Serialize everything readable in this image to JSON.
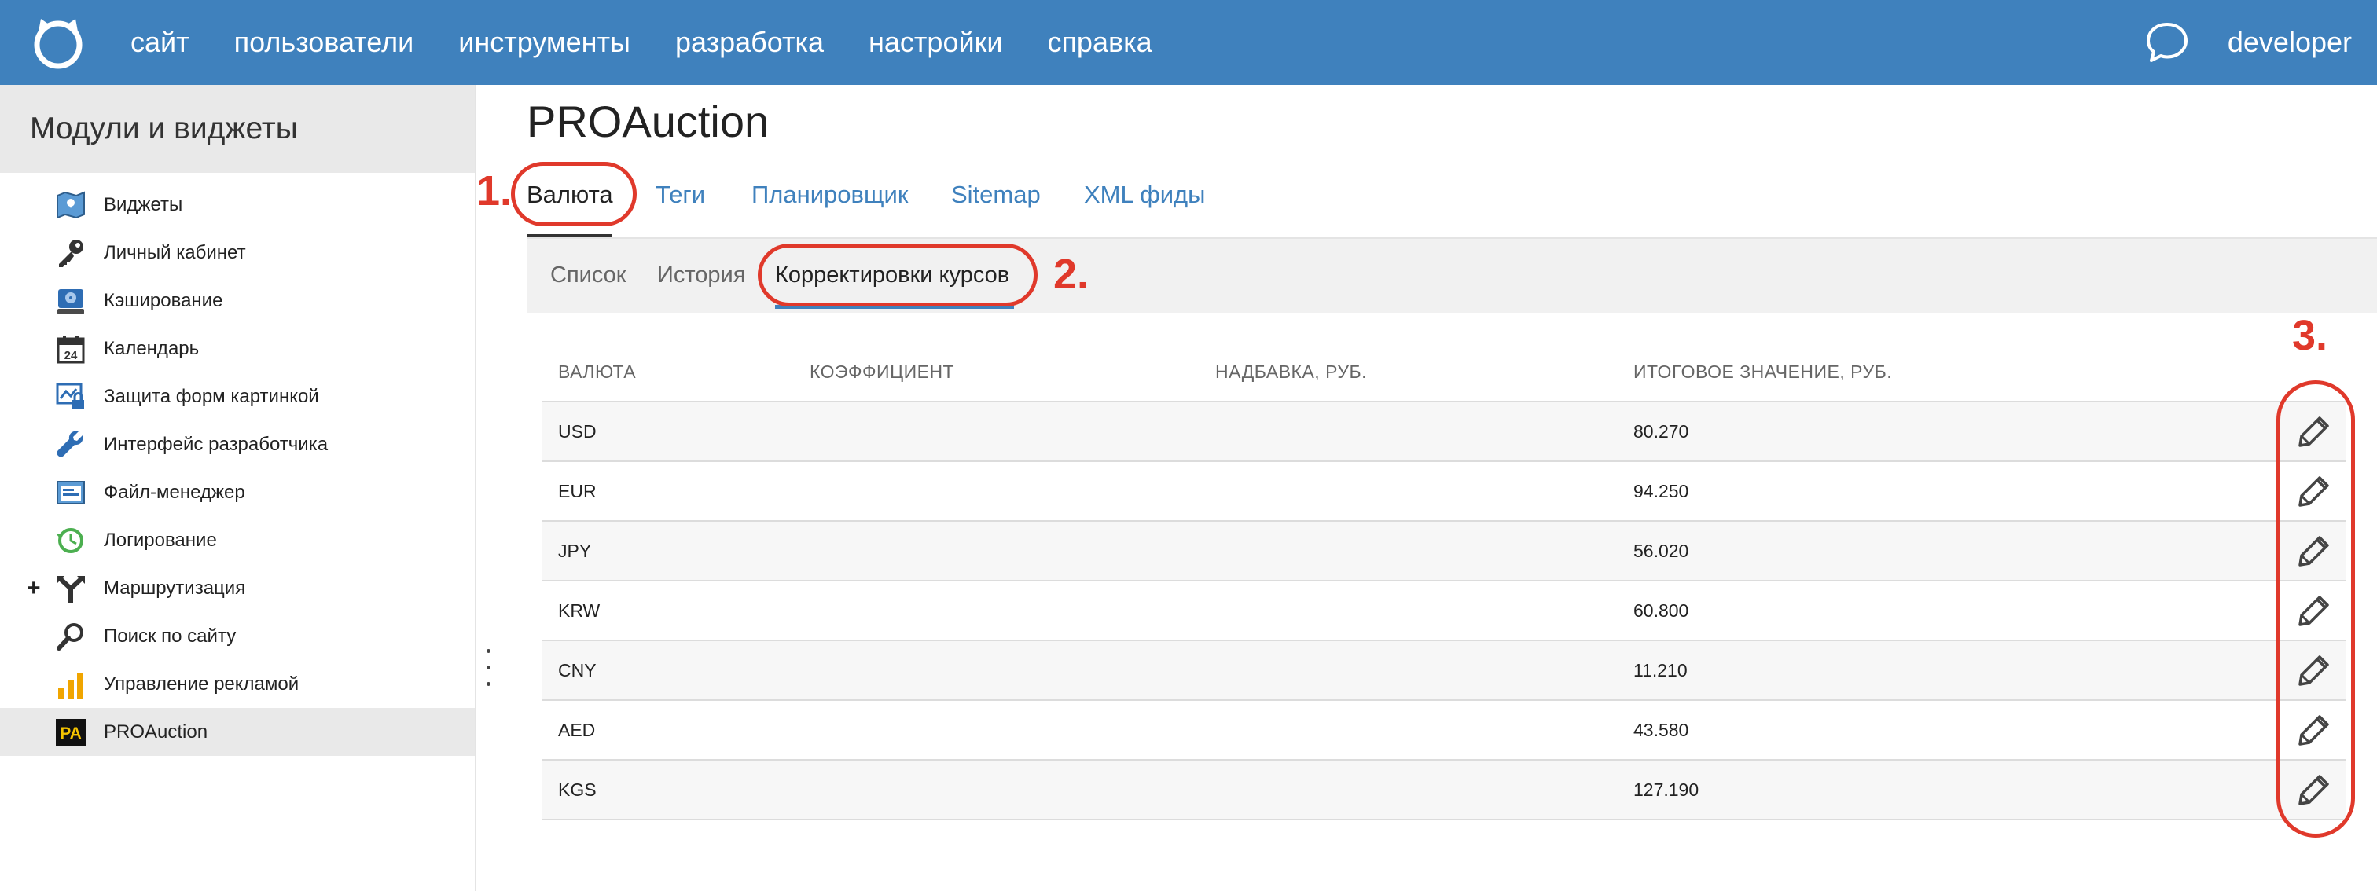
{
  "topbar": {
    "nav": [
      "сайт",
      "пользователи",
      "инструменты",
      "разработка",
      "настройки",
      "справка"
    ],
    "user": "developer",
    "logo_icon": "cat-logo-icon",
    "chat_icon": "chat-bubble-icon"
  },
  "sidebar": {
    "title": "Модули и виджеты",
    "items": [
      {
        "label": "Виджеты",
        "icon": "map-widgets-icon"
      },
      {
        "label": "Личный кабинет",
        "icon": "key-icon"
      },
      {
        "label": "Кэширование",
        "icon": "drive-icon"
      },
      {
        "label": "Календарь",
        "icon": "calendar-icon",
        "icon_text": "24"
      },
      {
        "label": "Защита форм картинкой",
        "icon": "captcha-lock-icon"
      },
      {
        "label": "Интерфейс разработчика",
        "icon": "wrench-icon"
      },
      {
        "label": "Файл-менеджер",
        "icon": "file-manager-icon"
      },
      {
        "label": "Логирование",
        "icon": "log-clock-icon"
      },
      {
        "label": "Маршрутизация",
        "icon": "routing-fork-icon",
        "expand": "+"
      },
      {
        "label": "Поиск по сайту",
        "icon": "magnifier-icon"
      },
      {
        "label": "Управление рекламой",
        "icon": "bar-chart-icon"
      },
      {
        "label": "PROAuction",
        "icon": "proauction-logo-icon",
        "icon_text": "PA",
        "active": true
      }
    ]
  },
  "main": {
    "title": "PROAuction",
    "tabs": [
      "Валюта",
      "Теги",
      "Планировщик",
      "Sitemap",
      "XML фиды"
    ],
    "active_tab": "Валюта",
    "subtabs": [
      "Список",
      "История",
      "Корректировки курсов"
    ],
    "active_subtab": "Корректировки курсов"
  },
  "table": {
    "headers": [
      "ВАЛЮТА",
      "КОЭФФИЦИЕНТ",
      "НАДБАВКА, РУБ.",
      "ИТОГОВОЕ ЗНАЧЕНИЕ, РУБ."
    ],
    "rows": [
      {
        "currency": "USD",
        "coef": "",
        "markup": "",
        "total": "80.270"
      },
      {
        "currency": "EUR",
        "coef": "",
        "markup": "",
        "total": "94.250"
      },
      {
        "currency": "JPY",
        "coef": "",
        "markup": "",
        "total": "56.020"
      },
      {
        "currency": "KRW",
        "coef": "",
        "markup": "",
        "total": "60.800"
      },
      {
        "currency": "CNY",
        "coef": "",
        "markup": "",
        "total": "11.210"
      },
      {
        "currency": "AED",
        "coef": "",
        "markup": "",
        "total": "43.580"
      },
      {
        "currency": "KGS",
        "coef": "",
        "markup": "",
        "total": "127.190"
      }
    ],
    "row_action_icon": "pencil-edit-icon"
  },
  "annotations": {
    "step1": "1.",
    "step2": "2.",
    "step3": "3.",
    "color": "#e0392b"
  },
  "colors": {
    "brand_blue": "#3f81bd",
    "sidebar_header_bg": "#e9e9e9",
    "subtabs_bg": "#f1f1f1"
  }
}
